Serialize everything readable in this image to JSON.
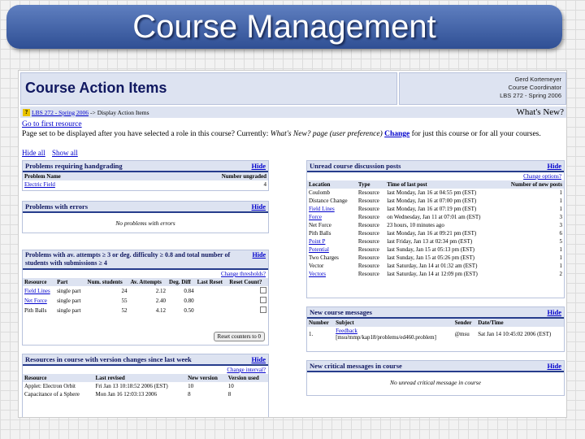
{
  "slide_title": "Course Management",
  "header": {
    "title": "Course Action Items",
    "user_lines": [
      "Gerd Kortemeyer",
      "Course Coordinator",
      "LBS 272 - Spring 2006"
    ]
  },
  "breadcrumb": {
    "course_link": "LBS 272 - Spring 2006",
    "separator": "->",
    "current": "Display Action Items",
    "whats_new": "What's New?"
  },
  "intro": {
    "first_resource": "Go to first resource",
    "role_text": "Page set to be displayed after you have selected a role in this course? Currently:",
    "current_page": "What's New? page (user preference)",
    "change_label": "Change",
    "change_suffix": "for just this course or for all your courses.",
    "hide_all": "Hide all",
    "show_all": "Show all"
  },
  "panels": {
    "handgrading": {
      "title": "Problems requiring handgrading",
      "hide": "Hide",
      "columns": [
        "Problem Name",
        "Number ungraded"
      ],
      "rows": [
        [
          "Electric Field",
          "4"
        ]
      ]
    },
    "errors": {
      "title": "Problems with errors",
      "hide": "Hide",
      "empty": "No problems with errors"
    },
    "attempts": {
      "title": "Problems with av. attempts ≥ 3 or deg. difficulty ≥ 0.8 and total number of students with submissions ≥ 4",
      "hide": "Hide",
      "change_link": "Change thresholds?",
      "columns": [
        "Resource",
        "Part",
        "Num. students",
        "Av. Attempts",
        "Deg. Diff",
        "Last Reset",
        "Reset Count?"
      ],
      "rows": [
        [
          "Field Lines",
          "single part",
          "24",
          "2.12",
          "0.84"
        ],
        [
          "Net Force",
          "single part",
          "55",
          "2.40",
          "0.80"
        ],
        [
          "Pith Balls",
          "single part",
          "52",
          "4.12",
          "0.50"
        ]
      ],
      "reset_button": "Reset counters to 0"
    },
    "versions": {
      "title": "Resources in course with version changes since last week",
      "hide": "Hide",
      "change_link": "Change interval?",
      "columns": [
        "Resource",
        "Last revised",
        "New version",
        "Version used"
      ],
      "rows": [
        [
          "Applet: Electron Orbit",
          "Fri Jan 13 10:18:52 2006 (EST)",
          "10",
          "10"
        ],
        [
          "Capacitance of a Sphere",
          "Mon Jan 16 12:03:13 2006",
          "8",
          "8"
        ]
      ]
    },
    "discussion": {
      "title": "Unread course discussion posts",
      "hide": "Hide",
      "change_link": "Change options?",
      "columns": [
        "Location",
        "Type",
        "Time of last post",
        "Number of new posts"
      ],
      "rows": [
        [
          "Coulomb",
          "Resource",
          "last Monday, Jan 16 at 04:55 pm (EST)",
          "1"
        ],
        [
          "Distance Change",
          "Resource",
          "last Monday, Jan 16 at 07:00 pm (EST)",
          "1"
        ],
        [
          "Field Lines",
          "Resource",
          "last Monday, Jan 16 at 07:19 pm (EST)",
          "1"
        ],
        [
          "Force",
          "Resource",
          "on Wednesday, Jan 11 at 07:01 am (EST)",
          "3"
        ],
        [
          "Net Force",
          "Resource",
          "23 hours, 10 minutes ago",
          "3"
        ],
        [
          "Pith Balls",
          "Resource",
          "last Monday, Jan 16 at 09:21 pm (EST)",
          "6"
        ],
        [
          "Point P",
          "Resource",
          "last Friday, Jan 13 at 02:34 pm (EST)",
          "5"
        ],
        [
          "Potential",
          "Resource",
          "last Sunday, Jan 15 at 05:13 pm (EST)",
          "1"
        ],
        [
          "Two Charges",
          "Resource",
          "last Sunday, Jan 15 at 05:26 pm (EST)",
          "1"
        ],
        [
          "Vector",
          "Resource",
          "last Saturday, Jan 14 at 01:32 am (EST)",
          "1"
        ],
        [
          "Vectors",
          "Resource",
          "last Saturday, Jan 14 at 12:09 pm (EST)",
          "2"
        ]
      ]
    },
    "messages": {
      "title": "New course messages",
      "hide": "Hide",
      "columns": [
        "Number",
        "Subject",
        "Sender",
        "Date/Time"
      ],
      "row": {
        "num": "1.",
        "subject": "Feedback",
        "path": "[msu/mmp/kap18/problems/ed460.problem]",
        "sender": "@msu",
        "date": "Sat Jan 14 10:45:02 2006 (EST)"
      }
    },
    "critical": {
      "title": "New critical messages in course",
      "hide": "Hide",
      "empty": "No unread critical message in course"
    }
  }
}
